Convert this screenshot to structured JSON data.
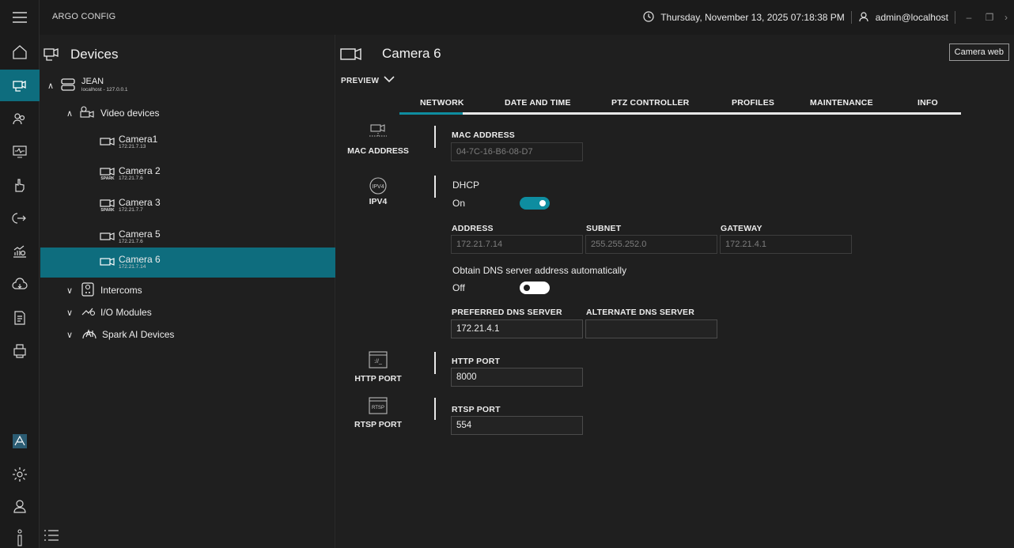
{
  "app": {
    "title": "ARGO CONFIG",
    "datetime": "Thursday, November 13, 2025 07:18:38 PM",
    "user": "admin@localhost"
  },
  "tree": {
    "title": "Devices",
    "server": {
      "name": "JEAN",
      "address": "localhost - 127.0.0.1"
    },
    "video_group": "Video devices",
    "cameras": [
      {
        "name": "Camera1",
        "ip": "172.21.7.13",
        "brand": ""
      },
      {
        "name": "Camera 2",
        "ip": "172.21.7.6",
        "brand": "SPARK"
      },
      {
        "name": "Camera 3",
        "ip": "172.21.7.7",
        "brand": "SPARK"
      },
      {
        "name": "Camera 5",
        "ip": "172.21.7.6",
        "brand": ""
      },
      {
        "name": "Camera 6",
        "ip": "172.21.7.14",
        "brand": ""
      }
    ],
    "groups": [
      "Intercoms",
      "I/O Modules",
      "Spark AI Devices"
    ]
  },
  "main": {
    "camera_title": "Camera 6",
    "camera_web_label": "Camera web",
    "preview_label": "PREVIEW",
    "tabs": [
      "NETWORK",
      "DATE AND TIME",
      "PTZ CONTROLLER",
      "PROFILES",
      "MAINTENANCE",
      "INFO"
    ],
    "active_tab": "NETWORK",
    "mac": {
      "section": "MAC ADDRESS",
      "label": "MAC ADDRESS",
      "value": "04-7C-16-B6-08-D7"
    },
    "ipv4": {
      "section": "IPV4",
      "icon_text": "IPV4",
      "dhcp_label": "DHCP",
      "dhcp_state": "On",
      "address_label": "ADDRESS",
      "address": "172.21.7.14",
      "subnet_label": "SUBNET",
      "subnet": "255.255.252.0",
      "gateway_label": "GATEWAY",
      "gateway": "172.21.4.1",
      "dns_auto_label": "Obtain DNS server address automatically",
      "dns_auto_state": "Off",
      "preferred_dns_label": "PREFERRED DNS SERVER",
      "preferred_dns": "172.21.4.1",
      "alternate_dns_label": "ALTERNATE DNS SERVER",
      "alternate_dns": ""
    },
    "http": {
      "section": "HTTP PORT",
      "icon_text": "://_",
      "label": "HTTP PORT",
      "value": "8000"
    },
    "rtsp": {
      "section": "RTSP PORT",
      "icon_text": "RTSP",
      "label": "RTSP PORT",
      "value": "554"
    }
  },
  "colors": {
    "accent": "#0e6d7e",
    "toggle_on": "#0e8da0",
    "background": "#1f1f1f"
  }
}
